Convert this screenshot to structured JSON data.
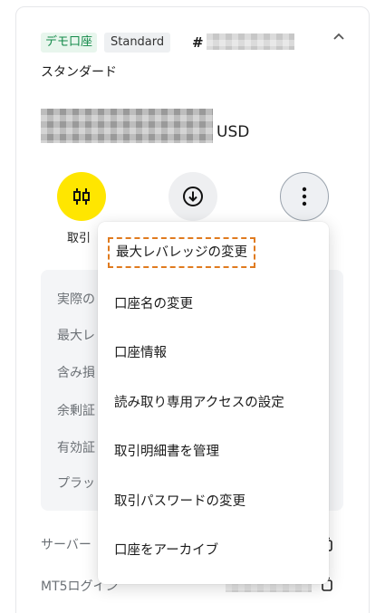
{
  "account": {
    "demo_badge": "デモ口座",
    "type_badge": "Standard",
    "number_prefix": "#",
    "name": "スタンダード",
    "currency": "USD"
  },
  "actions": {
    "trade_label": "取引"
  },
  "details": {
    "labels": [
      "実際の",
      "最大レ",
      "含み損",
      "余剰証",
      "有効証",
      "プラット"
    ]
  },
  "footer": {
    "server_label": "サーバー",
    "login_label": "MT5ログイン"
  },
  "menu": {
    "items": [
      "最大レバレッジの変更",
      "口座名の変更",
      "口座情報",
      "読み取り専用アクセスの設定",
      "取引明細書を管理",
      "取引パスワードの変更",
      "口座をアーカイブ"
    ]
  },
  "colors": {
    "trade_button": "#ffe600",
    "demo_badge_bg": "#e8f6ed",
    "demo_badge_text": "#148a4a",
    "highlight_outline": "#e07b1f"
  },
  "icons": {
    "trade": "candlestick-icon",
    "deposit": "arrow-down-circle-icon",
    "more": "kebab-icon",
    "collapse": "chevron-up-icon",
    "copy": "copy-icon"
  }
}
